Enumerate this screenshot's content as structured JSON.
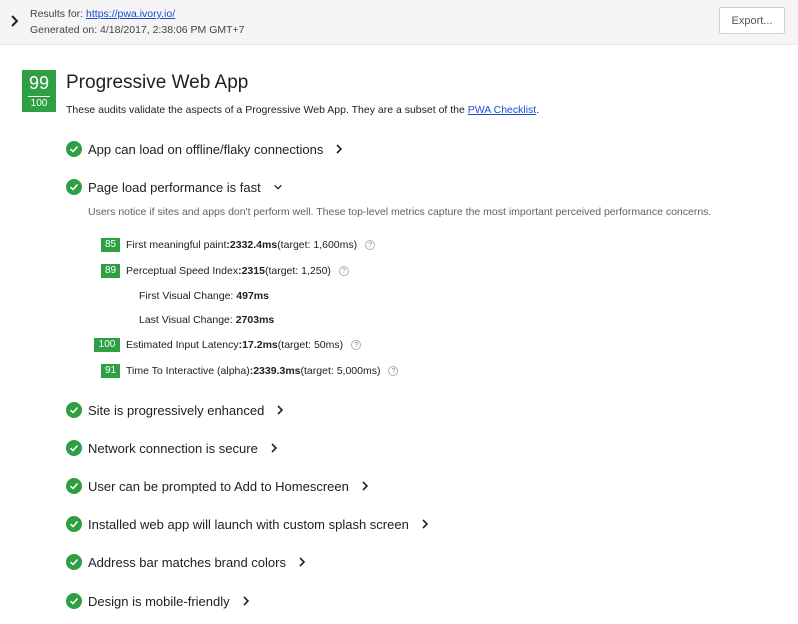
{
  "header": {
    "results_label": "Results for: ",
    "url": "https://pwa.ivory.io/",
    "generated": "Generated on: 4/18/2017, 2:38:06 PM GMT+7",
    "export_label": "Export..."
  },
  "section": {
    "score": "99",
    "score_max": "100",
    "title": "Progressive Web App",
    "desc_prefix": "These audits validate the aspects of a Progressive Web App. They are a subset of the ",
    "desc_link": "PWA Checklist",
    "desc_suffix": "."
  },
  "audits": [
    {
      "label": "App can load on offline/flaky connections"
    },
    {
      "label": "Page load performance is fast"
    },
    {
      "label": "Site is progressively enhanced"
    },
    {
      "label": "Network connection is secure"
    },
    {
      "label": "User can be prompted to Add to Homescreen"
    },
    {
      "label": "Installed web app will launch with custom splash screen"
    },
    {
      "label": "Address bar matches brand colors"
    },
    {
      "label": "Design is mobile-friendly"
    }
  ],
  "perf_group": {
    "desc": "Users notice if sites and apps don't perform well. These top-level metrics capture the most important perceived performance concerns.",
    "metrics": [
      {
        "score": "85",
        "name": "First meaningful paint",
        "sep": ": ",
        "value": "2332.4ms",
        "target": " (target: 1,600ms)"
      },
      {
        "score": "89",
        "name": "Perceptual Speed Index",
        "sep": ": ",
        "value": "2315",
        "target": " (target: 1,250)"
      },
      {
        "score": "100",
        "name": "Estimated Input Latency",
        "sep": ": ",
        "value": "17.2ms",
        "target": " (target: 50ms)"
      },
      {
        "score": "91",
        "name": "Time To Interactive (alpha)",
        "sep": ": ",
        "value": "2339.3ms",
        "target": " (target: 5,000ms)"
      }
    ],
    "submetrics": [
      {
        "name": "First Visual Change: ",
        "value": "497ms"
      },
      {
        "name": "Last Visual Change: ",
        "value": "2703ms"
      }
    ],
    "help_glyph": "?"
  },
  "colors": {
    "pass": "#2e9f43",
    "link": "#1a4bd1"
  }
}
